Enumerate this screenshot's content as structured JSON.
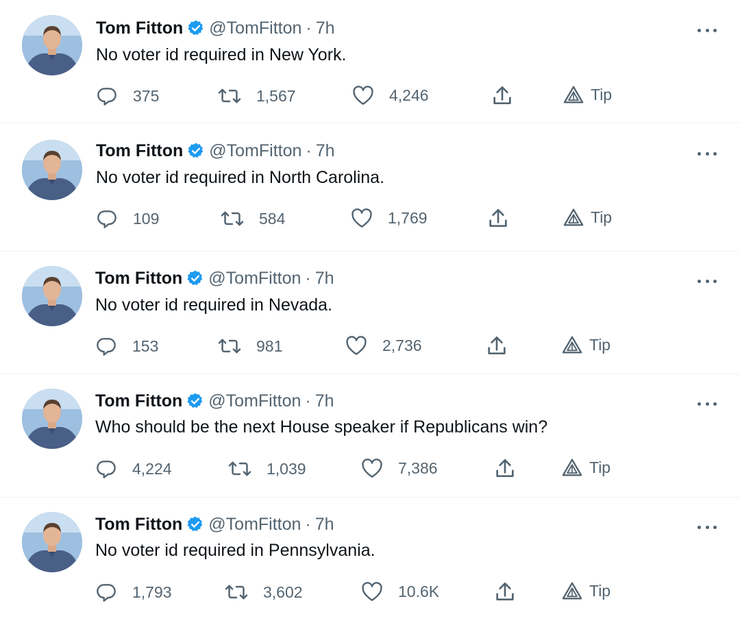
{
  "accent_color": "#1d9bf0",
  "text_color": "#0f1419",
  "muted_color": "#536471",
  "tweets": [
    {
      "author": {
        "name": "Tom Fitton",
        "handle": "@TomFitton",
        "verified": true
      },
      "separator": "·",
      "time": "7h",
      "text": "No voter id required in New York.",
      "replies": "375",
      "retweets": "1,567",
      "likes": "4,246",
      "tip_label": "Tip"
    },
    {
      "author": {
        "name": "Tom Fitton",
        "handle": "@TomFitton",
        "verified": true
      },
      "separator": "·",
      "time": "7h",
      "text": "No voter id required in North Carolina.",
      "replies": "109",
      "retweets": "584",
      "likes": "1,769",
      "tip_label": "Tip"
    },
    {
      "author": {
        "name": "Tom Fitton",
        "handle": "@TomFitton",
        "verified": true
      },
      "separator": "·",
      "time": "7h",
      "text": "No voter id required in Nevada.",
      "replies": "153",
      "retweets": "981",
      "likes": "2,736",
      "tip_label": "Tip"
    },
    {
      "author": {
        "name": "Tom Fitton",
        "handle": "@TomFitton",
        "verified": true
      },
      "separator": "·",
      "time": "7h",
      "text": "Who should be the next House speaker if Republicans win?",
      "replies": "4,224",
      "retweets": "1,039",
      "likes": "7,386",
      "tip_label": "Tip"
    },
    {
      "author": {
        "name": "Tom Fitton",
        "handle": "@TomFitton",
        "verified": true
      },
      "separator": "·",
      "time": "7h",
      "text": "No voter id required in Pennsylvania.",
      "replies": "1,793",
      "retweets": "3,602",
      "likes": "10.6K",
      "tip_label": "Tip"
    }
  ],
  "icons": {
    "reply": "reply-icon",
    "retweet": "retweet-icon",
    "like": "heart-icon",
    "share": "share-icon",
    "tip": "tip-icon",
    "more": "more-icon",
    "verified": "verified-badge-icon"
  }
}
